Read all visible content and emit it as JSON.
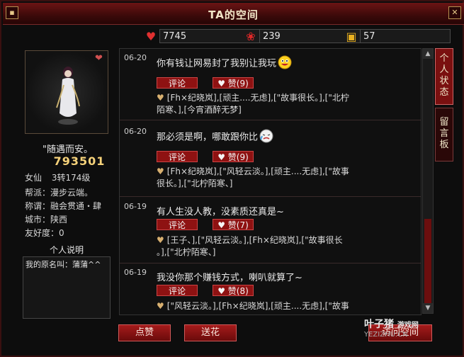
{
  "window": {
    "title": "TA的空间"
  },
  "stats": {
    "hearts": "7745",
    "flowers": "239",
    "gifts": "57"
  },
  "profile": {
    "motto": "\"随遇而安。",
    "score": "793501",
    "gender_class": "女仙",
    "level": "3转174级",
    "faction_label": "帮派：漫步云端。",
    "title_label": "称谓：融会贯通・肆",
    "city_label": "城市：陕西",
    "friendliness_label": "友好度：0",
    "desc_title": "个人说明",
    "desc_text": "我的原名叫：蒲蒲^^"
  },
  "tabs": {
    "status": "个人状态",
    "guestbook": "留言板"
  },
  "feed": {
    "comment_label": "评论",
    "posts": [
      {
        "date": "06-20",
        "text": "你有钱让网易封了我别让我玩",
        "likes": "赞(9)",
        "likers": "[Fh×纪晓岚],[顽主....无虑],[\"故事很长。],[\"北柠\n陌寒、],[今宵酒醉无梦]"
      },
      {
        "date": "06-20",
        "text": "那必须是啊，哪敢跟你比",
        "likes": "赞(9)",
        "likers": "[Fh×纪晓岚],[\"风轻云淡。],[顽主....无虑],[\"故事\n很长。],[\"北柠陌寒、]"
      },
      {
        "date": "06-19",
        "text": "有人生没人教，没素质还真是~",
        "likes": "赞(7)",
        "likers": "[王子、],[\"风轻云淡。],[Fh×纪晓岚],[\"故事很长\n。],[\"北柠陌寒、]"
      },
      {
        "date": "06-19",
        "text": "我没你那个赚钱方式，喇叭就算了~",
        "likes": "赞(8)",
        "likers": "[\"风轻云淡。],[Fh×纪晓岚],[顽主....无虑],[\"故事"
      }
    ]
  },
  "buttons": {
    "like": "点赞",
    "send_flower": "送花",
    "visit": "访问空间"
  },
  "watermark": {
    "brand": "叶子猪",
    "sub": "游戏网",
    "domain": "YEZIZHU.CN"
  },
  "colors": {
    "accent": "#8e1212",
    "gold": "#f6d27a"
  }
}
